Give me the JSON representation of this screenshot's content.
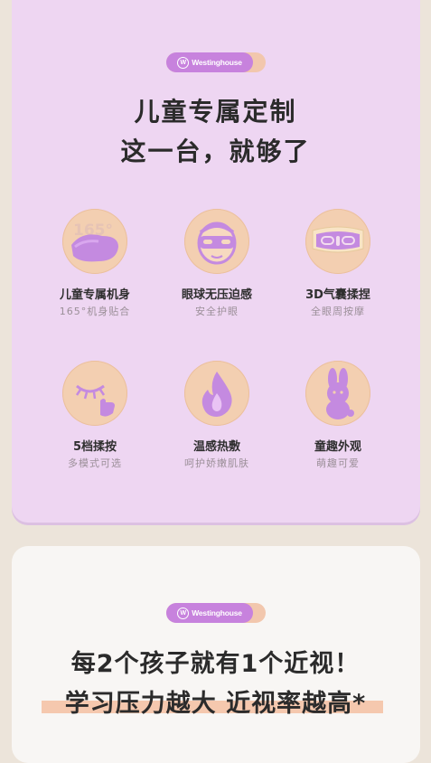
{
  "brand": {
    "badge_label": "Westinghouse",
    "logo_letter": "W"
  },
  "hero": {
    "line1": "儿童专属定制",
    "line2": "这一台，就够了"
  },
  "features": [
    {
      "title": "儿童专属机身",
      "subtitle": "165°机身贴合",
      "icon": "eye-mask-angle-icon",
      "icon_text": "165°"
    },
    {
      "title": "眼球无压迫感",
      "subtitle": "安全护眼",
      "icon": "mask-face-icon"
    },
    {
      "title": "3D气囊揉捏",
      "subtitle": "全眼周按摩",
      "icon": "airbag-mask-icon"
    },
    {
      "title": "5档揉按",
      "subtitle": "多模式可选",
      "icon": "closed-eye-press-icon"
    },
    {
      "title": "温感热敷",
      "subtitle": "呵护娇嫩肌肤",
      "icon": "flame-icon"
    },
    {
      "title": "童趣外观",
      "subtitle": "萌趣可爱",
      "icon": "bunny-icon"
    }
  ],
  "section2": {
    "line1": "每2个孩子就有1个近视！",
    "line2": "学习压力越大 近视率越高*"
  },
  "colors": {
    "card_purple": "#eed6f2",
    "icon_purple": "#c48ae0",
    "icon_peach": "#f3cfb1"
  }
}
